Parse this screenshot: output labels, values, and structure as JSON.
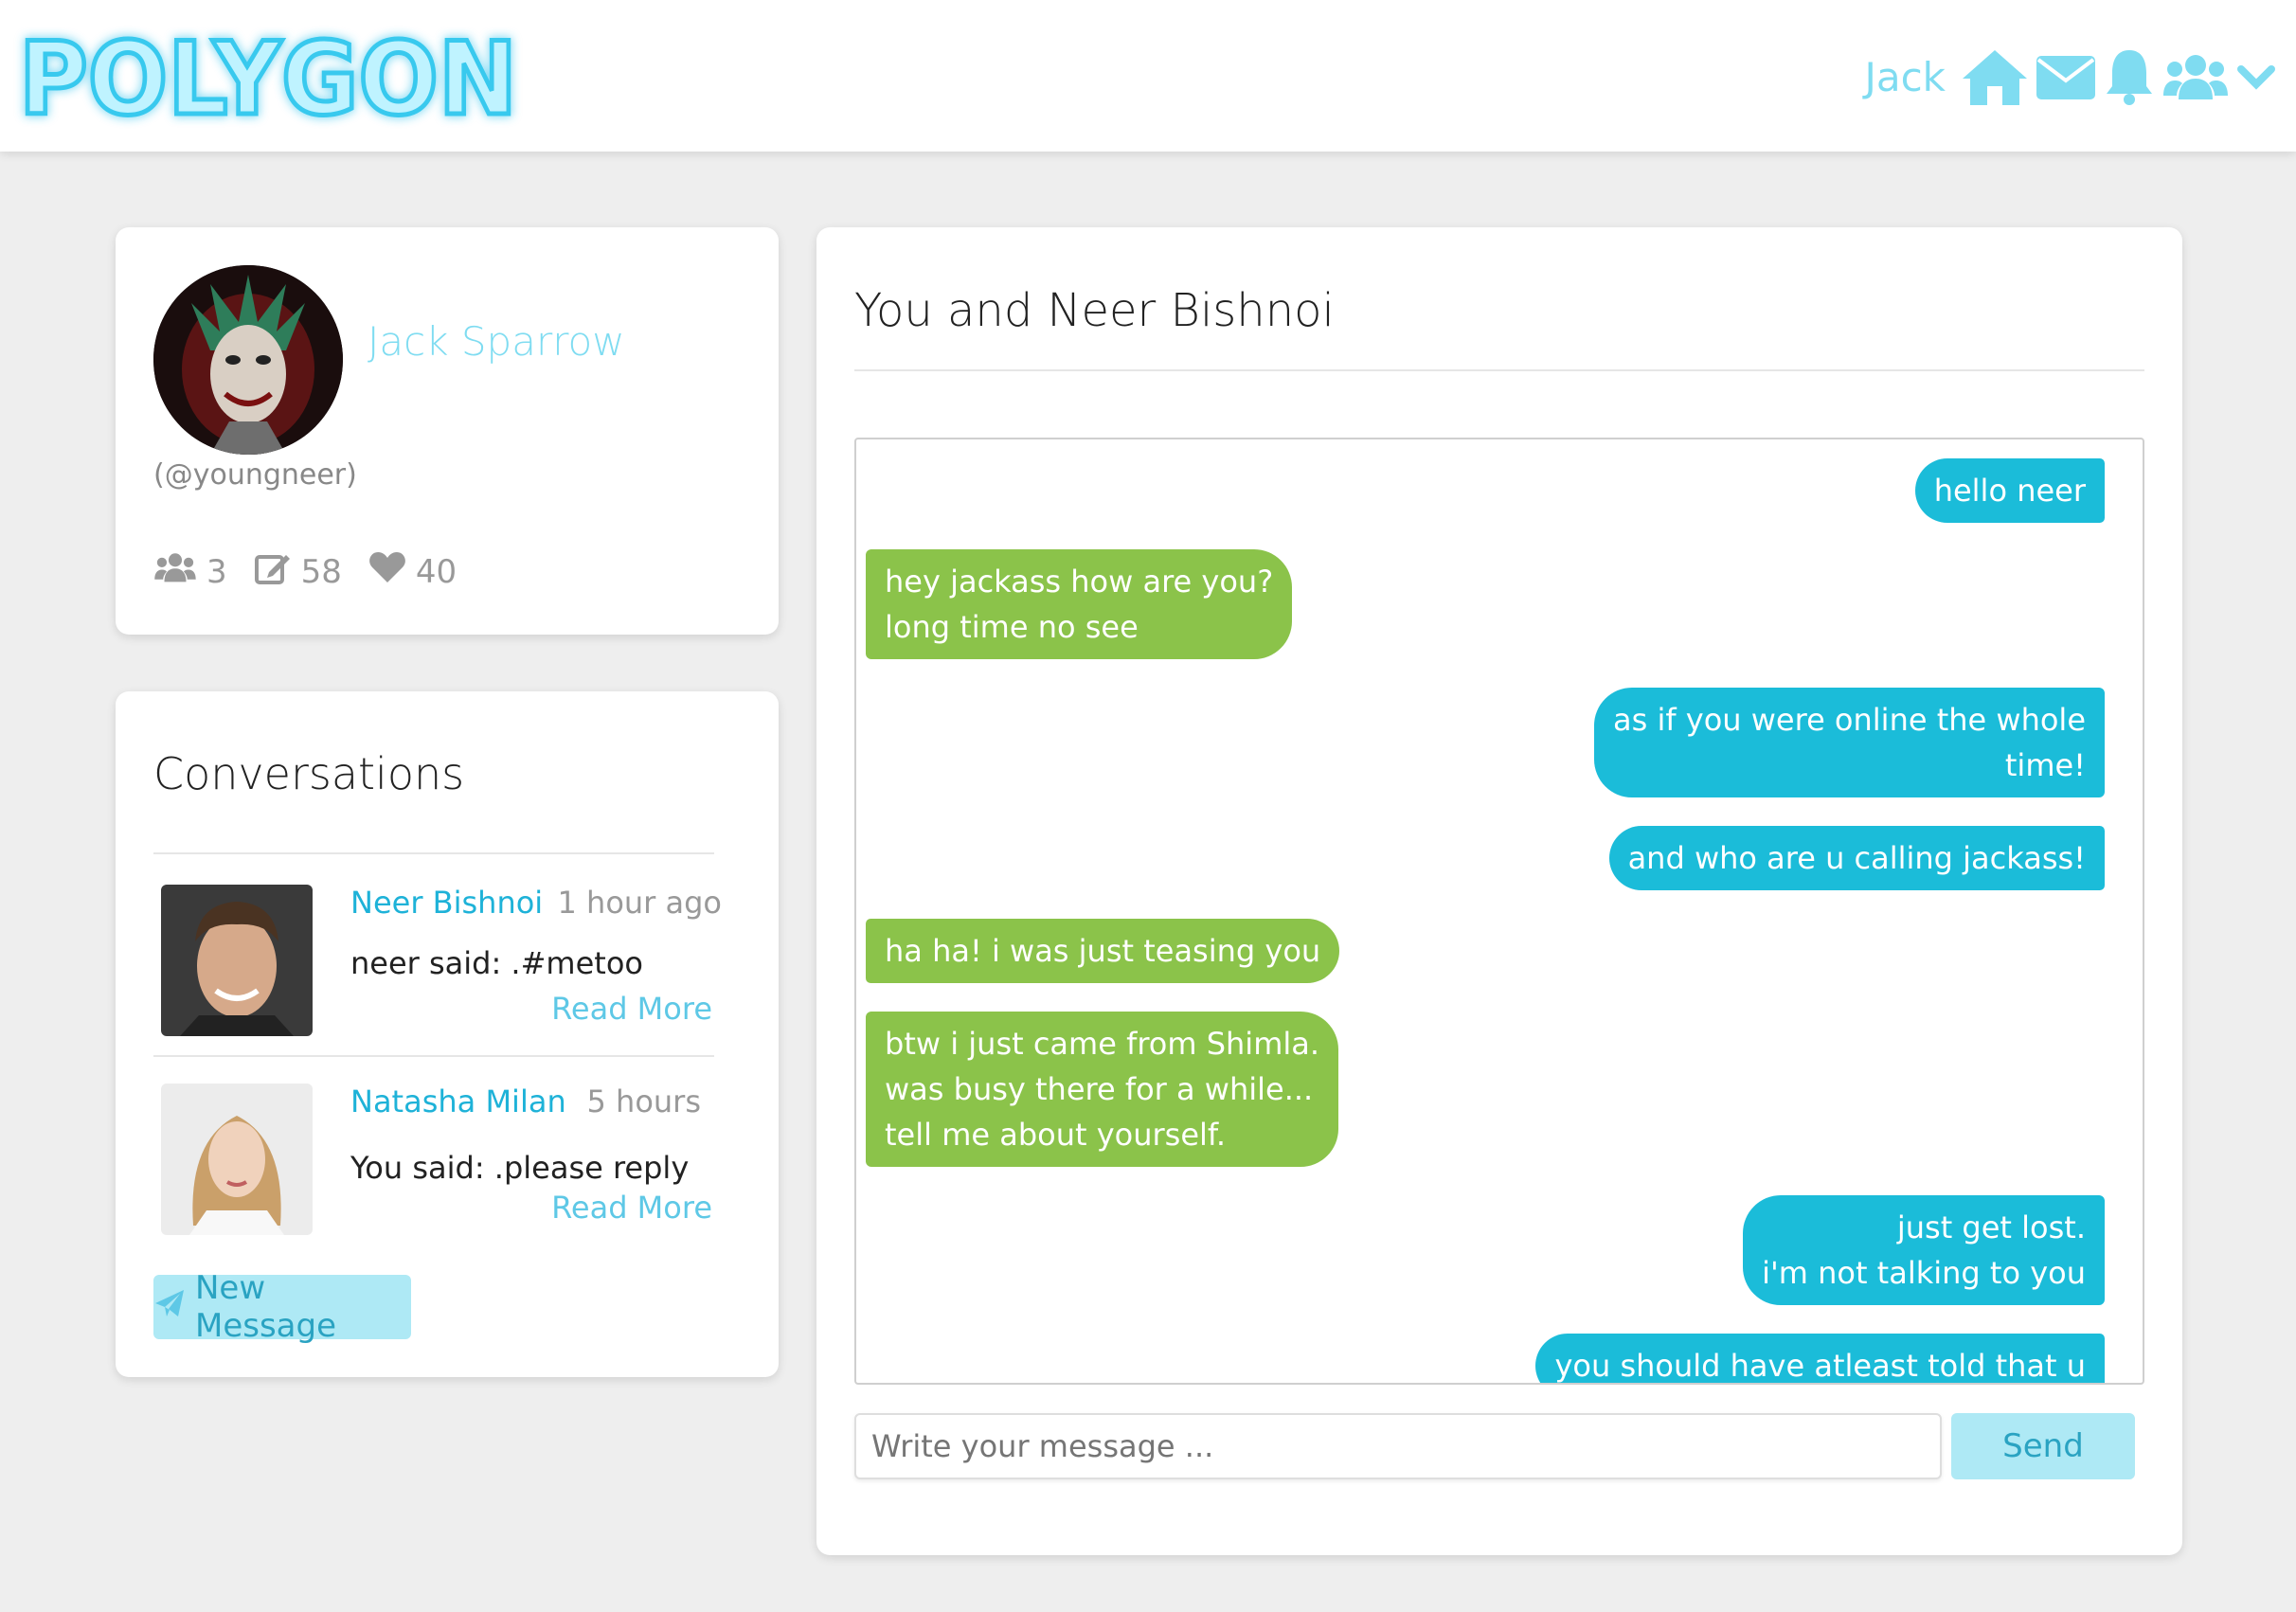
{
  "header": {
    "logo_text": "POLYGON",
    "username": "Jack",
    "icons": [
      "home-icon",
      "envelope-icon",
      "bell-icon",
      "users-icon",
      "chevron-down-icon"
    ],
    "accent_color": "#7fdcf1"
  },
  "profile": {
    "name": "Jack Sparrow",
    "handle": "(@youngneer)",
    "stats": {
      "friends": "3",
      "posts": "58",
      "likes": "40"
    }
  },
  "conversations": {
    "title": "Conversations",
    "items": [
      {
        "name": "Neer Bishnoi",
        "time": "1 hour ago",
        "message": "neer said: .#metoo",
        "read_more": "Read More"
      },
      {
        "name": "Natasha Milan",
        "time": "5 hours",
        "message": "You said: .please reply",
        "read_more": "Read More"
      }
    ],
    "new_message_label": "New Message"
  },
  "chat": {
    "title": "You and Neer Bishnoi",
    "messages": [
      {
        "from": "me",
        "lines": [
          "hello neer"
        ]
      },
      {
        "from": "them",
        "lines": [
          "hey jackass how are you?",
          "long time no see"
        ]
      },
      {
        "from": "me",
        "lines": [
          "as if you were online the whole",
          "time!"
        ]
      },
      {
        "from": "me",
        "lines": [
          "and who are u calling jackass!"
        ]
      },
      {
        "from": "them",
        "lines": [
          "ha ha! i was just teasing you"
        ]
      },
      {
        "from": "them",
        "lines": [
          "btw i just came from Shimla.",
          "was busy there for a while...",
          "tell me about yourself."
        ]
      },
      {
        "from": "me",
        "lines": [
          "just get lost.",
          "i'm not talking to you"
        ]
      },
      {
        "from": "me",
        "lines": [
          "you should have atleast told that u"
        ]
      }
    ],
    "input_placeholder": "Write your message ...",
    "send_label": "Send",
    "colors": {
      "me": "#1bbcd9",
      "them": "#8bc34a"
    }
  }
}
